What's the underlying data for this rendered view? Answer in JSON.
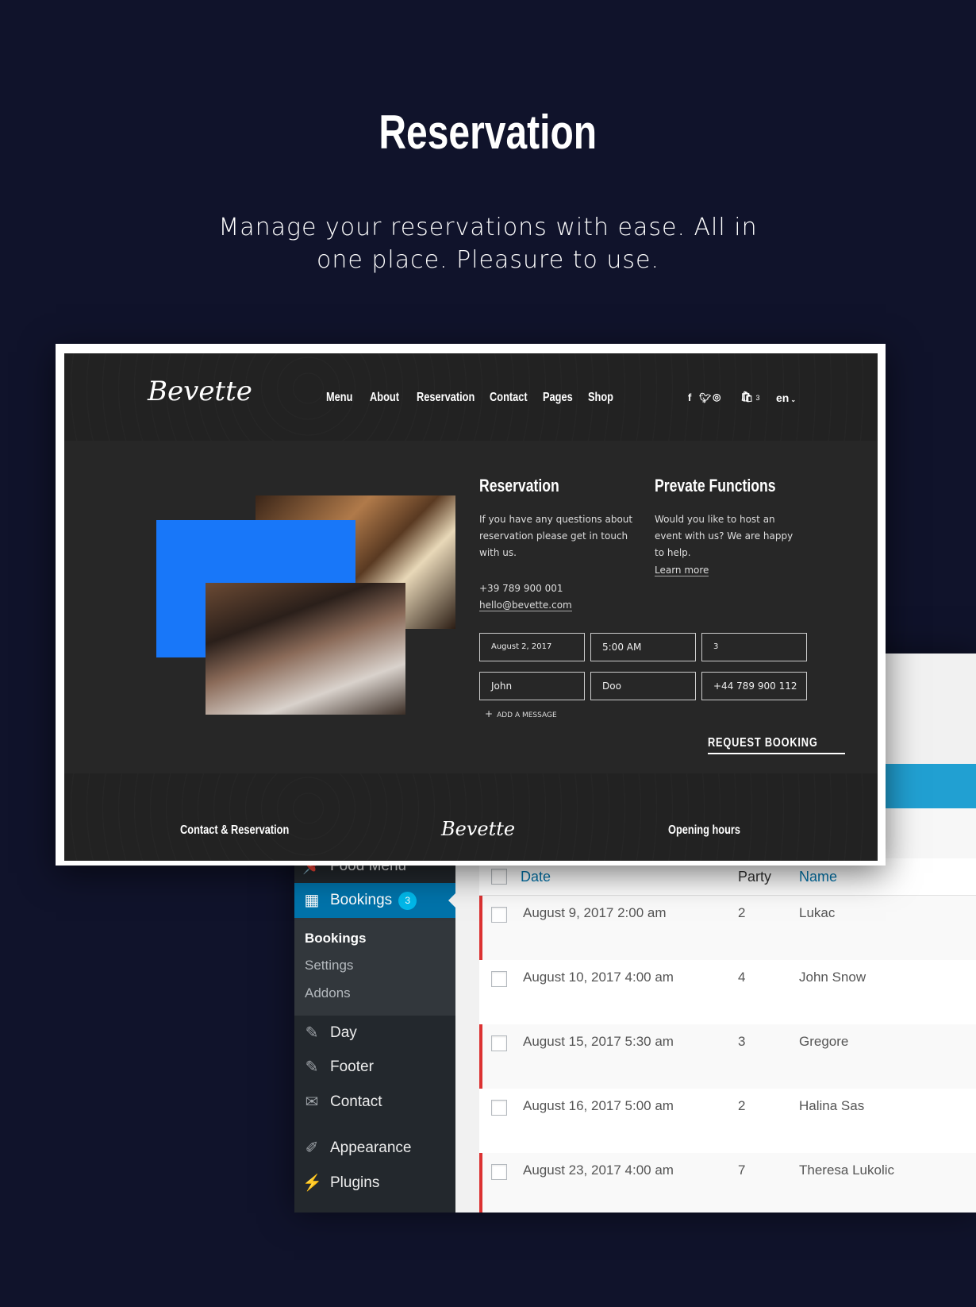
{
  "hero": {
    "title": "Reservation",
    "subtitle": "Manage your reservations with ease. All in one place. Pleasure to use."
  },
  "site": {
    "logo": "Bevette",
    "nav": [
      "Menu",
      "About",
      "Reservation",
      "Contact",
      "Pages",
      "Shop"
    ],
    "cart_count": "3",
    "language": "en",
    "reservation": {
      "title": "Reservation",
      "text": "If you have any questions about reservation please get in touch with us.",
      "phone": "+39 789 900 001",
      "email": "hello@bevette.com"
    },
    "functions": {
      "title": "Prevate Functions",
      "text": "Would you like to host an event with us? We are happy to help.",
      "link": "Learn more"
    },
    "form": {
      "date": "August 2, 2017",
      "time": "5:00 AM",
      "guests": "3",
      "first_name": "John",
      "last_name": "Doo",
      "phone": "+44 789 900 112",
      "add_message": "ADD A MESSAGE",
      "submit": "REQUEST BOOKING"
    },
    "footer": {
      "left": "Contact & Reservation",
      "logo": "Bevette",
      "right": "Opening hours"
    },
    "colors": {
      "accent_blue": "#1877f9"
    }
  },
  "admin": {
    "sidebar": {
      "food_menu": "Food Menu",
      "bookings": "Bookings",
      "bookings_badge": "3",
      "submenu": [
        "Bookings",
        "Settings",
        "Addons"
      ],
      "items": [
        "Day",
        "Footer",
        "Contact",
        "Appearance",
        "Plugins"
      ]
    },
    "table": {
      "headers": {
        "date": "Date",
        "party": "Party",
        "name": "Name"
      },
      "rows": [
        {
          "date": "August 9, 2017 2:00 am",
          "party": "2",
          "name": "Lukac"
        },
        {
          "date": "August 10, 2017 4:00 am",
          "party": "4",
          "name": "John Snow"
        },
        {
          "date": "August 15, 2017 5:30 am",
          "party": "3",
          "name": "Gregore"
        },
        {
          "date": "August 16, 2017 5:00 am",
          "party": "2",
          "name": "Halina Sas"
        },
        {
          "date": "August 23, 2017 4:00 am",
          "party": "7",
          "name": "Theresa Lukolic"
        }
      ]
    },
    "colors": {
      "active": "#0073aa",
      "pending_border": "#dc3232"
    }
  }
}
